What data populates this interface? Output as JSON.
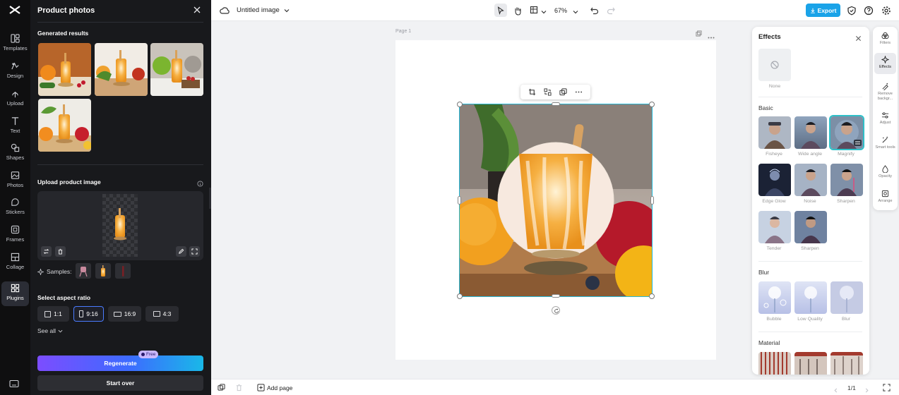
{
  "rail": {
    "items": [
      {
        "label": "Templates",
        "icon": "templates-icon"
      },
      {
        "label": "Design",
        "icon": "design-icon"
      },
      {
        "label": "Upload",
        "icon": "upload-icon"
      },
      {
        "label": "Text",
        "icon": "text-icon"
      },
      {
        "label": "Shapes",
        "icon": "shapes-icon"
      },
      {
        "label": "Photos",
        "icon": "photos-icon"
      },
      {
        "label": "Stickers",
        "icon": "stickers-icon"
      },
      {
        "label": "Frames",
        "icon": "frames-icon"
      },
      {
        "label": "Collage",
        "icon": "collage-icon"
      },
      {
        "label": "Plugins",
        "icon": "plugins-icon",
        "active": true
      }
    ]
  },
  "panel": {
    "title": "Product photos",
    "generated_heading": "Generated results",
    "upload_heading": "Upload product image",
    "samples_label": "Samples:",
    "aspect_heading": "Select aspect ratio",
    "ratios": [
      "1:1",
      "9:16",
      "16:9",
      "4:3"
    ],
    "selected_ratio": "9:16",
    "see_all": "See all",
    "regenerate": "Regenerate",
    "free_badge": "Free",
    "start_over": "Start over"
  },
  "topbar": {
    "doc_title": "Untitled image",
    "zoom": "67%",
    "export": "Export"
  },
  "canvas": {
    "page_label": "Page 1"
  },
  "bottombar": {
    "add_page": "Add page",
    "page_counter": "1/1"
  },
  "effects": {
    "title": "Effects",
    "none_label": "None",
    "basic_heading": "Basic",
    "basic": [
      "Fisheye",
      "Wide angle",
      "Magnify",
      "Edge Glow",
      "Noise",
      "Sharpen",
      "Tender",
      "Sharpen"
    ],
    "selected": "Magnify",
    "blur_heading": "Blur",
    "blur": [
      "Bubble",
      "Low Quality",
      "Blur"
    ],
    "material_heading": "Material"
  },
  "right_tools": [
    {
      "label": "Filters",
      "icon": "filters-icon"
    },
    {
      "label": "Effects",
      "icon": "effects-icon",
      "active": true
    },
    {
      "label": "Remove backgr...",
      "icon": "remove-background-icon"
    },
    {
      "label": "Adjust",
      "icon": "adjust-icon"
    },
    {
      "label": "Smart tools",
      "icon": "smart-tools-icon"
    },
    {
      "label": "Opacity",
      "icon": "opacity-icon"
    },
    {
      "label": "Arrange",
      "icon": "arrange-icon"
    }
  ],
  "colors": {
    "accent": "#1aa3e8",
    "selection": "#27b7d6",
    "rail_bg": "#0f0f10",
    "panel_bg": "#18191c"
  }
}
